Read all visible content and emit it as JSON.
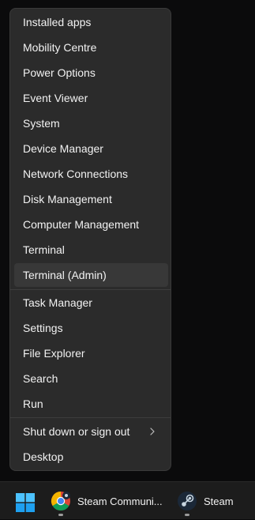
{
  "menu": {
    "group1": [
      {
        "label": "Installed apps"
      },
      {
        "label": "Mobility Centre"
      },
      {
        "label": "Power Options"
      },
      {
        "label": "Event Viewer"
      },
      {
        "label": "System"
      },
      {
        "label": "Device Manager"
      },
      {
        "label": "Network Connections"
      },
      {
        "label": "Disk Management"
      },
      {
        "label": "Computer Management"
      },
      {
        "label": "Terminal"
      },
      {
        "label": "Terminal (Admin)"
      }
    ],
    "group2": [
      {
        "label": "Task Manager"
      },
      {
        "label": "Settings"
      },
      {
        "label": "File Explorer"
      },
      {
        "label": "Search"
      },
      {
        "label": "Run"
      }
    ],
    "group3": [
      {
        "label": "Shut down or sign out",
        "icon": "chevron-right-icon"
      },
      {
        "label": "Desktop"
      }
    ],
    "highlighted": "Terminal (Admin)"
  },
  "taskbar": {
    "start_icon": "windows-logo-icon",
    "apps": [
      {
        "label": "Steam Communi...",
        "icon": "chrome-steam-icon"
      },
      {
        "label": "Steam",
        "icon": "steam-icon"
      }
    ]
  }
}
